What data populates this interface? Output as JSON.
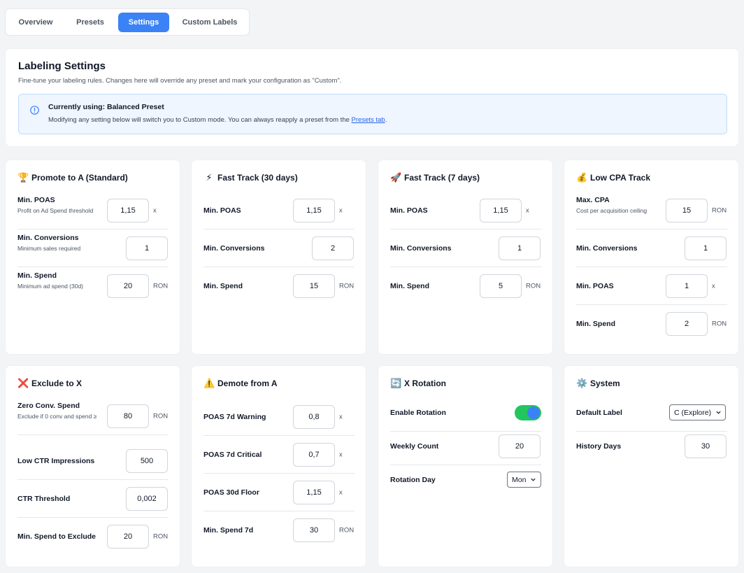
{
  "tabs": [
    {
      "label": "Overview"
    },
    {
      "label": "Presets"
    },
    {
      "label": "Settings"
    },
    {
      "label": "Custom Labels"
    }
  ],
  "header": {
    "title": "Labeling Settings",
    "subtitle": "Fine-tune your labeling rules. Changes here will override any preset and mark your configuration as \"Custom\".",
    "notice_title": "Currently using: Balanced Preset",
    "notice_body": "Modifying any setting below will switch you to Custom mode. You can always reapply a preset from the ",
    "notice_link": "Presets tab",
    "notice_end": "."
  },
  "cards": {
    "promote_a": {
      "emoji": "🏆",
      "title": "Promote to A (Standard)",
      "rows": [
        {
          "label": "Min. POAS",
          "hint": "Profit on Ad Spend threshold",
          "value": "1,15",
          "unit": "x"
        },
        {
          "label": "Min. Conversions",
          "hint": "Minimum sales required",
          "value": "1",
          "unit": ""
        },
        {
          "label": "Min. Spend",
          "hint": "Minimum ad spend (30d)",
          "value": "20",
          "unit": "RON"
        }
      ]
    },
    "fast_30": {
      "emoji": "⚡",
      "title": "Fast Track (30 days)",
      "rows": [
        {
          "label": "Min. POAS",
          "value": "1,15",
          "unit": "x"
        },
        {
          "label": "Min. Conversions",
          "value": "2",
          "unit": ""
        },
        {
          "label": "Min. Spend",
          "value": "15",
          "unit": "RON"
        }
      ]
    },
    "fast_7": {
      "emoji": "🚀",
      "title": "Fast Track (7 days)",
      "rows": [
        {
          "label": "Min. POAS",
          "value": "1,15",
          "unit": "x"
        },
        {
          "label": "Min. Conversions",
          "value": "1",
          "unit": ""
        },
        {
          "label": "Min. Spend",
          "value": "5",
          "unit": "RON"
        }
      ]
    },
    "low_cpa": {
      "emoji": "💰",
      "title": "Low CPA Track",
      "rows": [
        {
          "label": "Max. CPA",
          "hint": "Cost per acquisition ceiling",
          "value": "15",
          "unit": "RON"
        },
        {
          "label": "Min. Conversions",
          "value": "1",
          "unit": ""
        },
        {
          "label": "Min. POAS",
          "value": "1",
          "unit": "x"
        },
        {
          "label": "Min. Spend",
          "value": "2",
          "unit": "RON"
        }
      ]
    },
    "exclude_x": {
      "emoji": "❌",
      "title": "Exclude to X",
      "rows": [
        {
          "label": "Zero Conv. Spend",
          "hint": "Exclude if 0 conv and spend ≥",
          "value": "80",
          "unit": "RON"
        },
        {
          "label": "Low CTR Impressions",
          "value": "500",
          "unit": ""
        },
        {
          "label": "CTR Threshold",
          "value": "0,002",
          "unit": ""
        },
        {
          "label": "Min. Spend to Exclude",
          "value": "20",
          "unit": "RON"
        }
      ]
    },
    "demote_a": {
      "emoji": "⚠️",
      "title": "Demote from A",
      "rows": [
        {
          "label": "POAS 7d Warning",
          "value": "0,8",
          "unit": "x"
        },
        {
          "label": "POAS 7d Critical",
          "value": "0,7",
          "unit": "x"
        },
        {
          "label": "POAS 30d Floor",
          "value": "1,15",
          "unit": "x"
        },
        {
          "label": "Min. Spend 7d",
          "value": "30",
          "unit": "RON"
        }
      ]
    },
    "x_rotation": {
      "emoji": "🔄",
      "title": "X Rotation",
      "rows": [
        {
          "label": "Enable Rotation"
        },
        {
          "label": "Weekly Count",
          "value": "20"
        },
        {
          "label": "Rotation Day",
          "value": "Mon"
        }
      ]
    },
    "system": {
      "emoji": "⚙️",
      "title": "System",
      "rows": [
        {
          "label": "Default Label",
          "value": "C (Explore)"
        },
        {
          "label": "History Days",
          "value": "30"
        }
      ]
    }
  },
  "colors": {
    "accent": "#3b82f6",
    "toggle_on": "#22c55e"
  }
}
